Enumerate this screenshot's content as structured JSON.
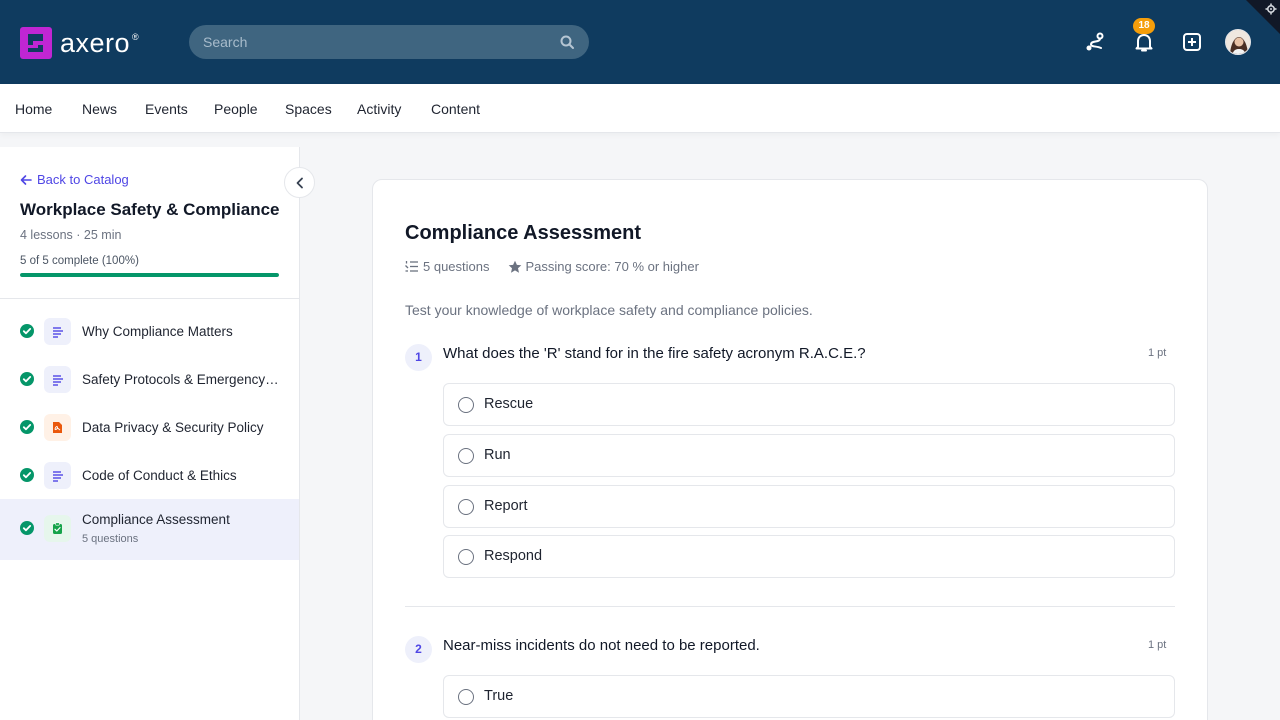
{
  "header": {
    "logo_text": "axero",
    "logo_reg": "®",
    "search_placeholder": "Search",
    "notification_count": "18",
    "colors": {
      "bar": "#0f3b5f",
      "brand": "#c026d3",
      "badge": "#f59e0b"
    }
  },
  "nav": {
    "items": [
      "Home",
      "News",
      "Events",
      "People",
      "Spaces",
      "Activity",
      "Content"
    ]
  },
  "sidebar": {
    "back_label": "Back to Catalog",
    "course_title": "Workplace Safety & Compliance",
    "course_meta": "4 lessons · 25 min",
    "progress_text": "5 of 5 complete (100%)",
    "progress_fraction": 1.0,
    "lessons": [
      {
        "label": "Why Compliance Matters",
        "icon": "document-icon",
        "complete": true
      },
      {
        "label": "Safety Protocols & Emergency Procedures",
        "icon": "document-icon",
        "complete": true
      },
      {
        "label": "Data Privacy & Security Policy",
        "icon": "pdf-icon",
        "complete": true
      },
      {
        "label": "Code of Conduct & Ethics",
        "icon": "document-icon",
        "complete": true
      },
      {
        "label": "Compliance Assessment",
        "sub": "5 questions",
        "icon": "quiz-icon",
        "complete": true,
        "active": true
      }
    ]
  },
  "assessment": {
    "title": "Compliance Assessment",
    "question_count": "5 questions",
    "passing_score": "Passing score: 70 % or higher",
    "description": "Test your knowledge of workplace safety and compliance policies.",
    "questions": [
      {
        "number": "1",
        "text": "What does the 'R' stand for in the fire safety acronym R.A.C.E.?",
        "points": "1 pt",
        "options": [
          "Rescue",
          "Run",
          "Report",
          "Respond"
        ]
      },
      {
        "number": "2",
        "text": "Near-miss incidents do not need to be reported.",
        "points": "1 pt",
        "options": [
          "True"
        ]
      }
    ]
  }
}
